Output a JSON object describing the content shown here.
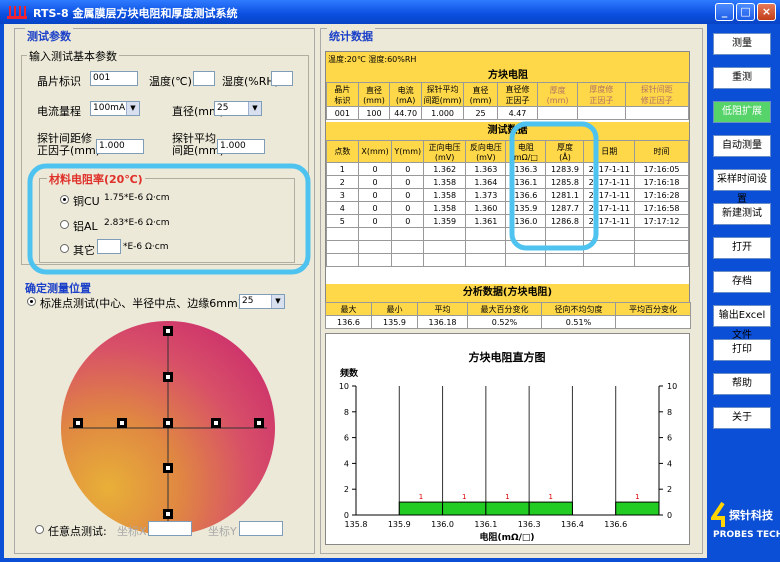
{
  "window": {
    "title": "RTS-8 金属膜层方块电阻和厚度测试系统",
    "minimize": "_",
    "maximize": "□",
    "close": "×"
  },
  "left": {
    "section_title": "测试参数",
    "basic_title": "输入测试基本参数",
    "sample_id_label": "晶片标识",
    "sample_id_value": "001",
    "temp_label": "温度(℃)",
    "temp_value": "",
    "humidity_label": "湿度(%RH)",
    "humidity_value": "",
    "current_range_label": "电流量程",
    "current_range_value": "100mA",
    "diameter_label": "直径(mm)",
    "diameter_value": "25",
    "spacing_corr_label_1": "探针间距修",
    "spacing_corr_label_2": "正因子(mm)",
    "spacing_corr_value": "1.000",
    "spacing_avg_label_1": "探针平均",
    "spacing_avg_label_2": "间距(mm)",
    "spacing_avg_value": "1.000",
    "resistivity_title": "材料电阻率(20℃)",
    "materials": [
      {
        "name": "铜CU",
        "value": "1.75*E-6 Ω·cm",
        "selected": true
      },
      {
        "name": "铝AL",
        "value": "2.83*E-6 Ω·cm",
        "selected": false
      }
    ],
    "other_label": "其它",
    "other_value": "",
    "other_unit": "*E-6 Ω·cm",
    "position_title": "确定测量位置",
    "standard_label": "标准点测试(中心、半径中点、边缘6mm)",
    "standard_value": "25",
    "free_label": "任意点测试:",
    "coord_x_label": "坐标X",
    "coord_y_label": "坐标Y"
  },
  "stats": {
    "section_title": "统计数据",
    "env": "温度:20℃  湿度:60%RH",
    "sheet_title": "方块电阻",
    "sheet_headers": [
      "晶片\n标识",
      "直径\n(mm)",
      "电流\n(mA)",
      "探针平均\n间距(mm)",
      "直径\n(mm)",
      "直径修\n正因子",
      "厚度\n(mm)",
      "厚度修\n正因子",
      "探针间距\n修正因子"
    ],
    "sheet_values": [
      "001",
      "100",
      "44.70",
      "1.000",
      "25",
      "4.47",
      "",
      "",
      ""
    ],
    "data_title": "测试数据",
    "data_headers": [
      "点数",
      "X(mm)",
      "Y(mm)",
      "正向电压\n(mV)",
      "反向电压\n(mV)",
      "电阻\nmΩ/□",
      "厚度\n(Å)",
      "日期",
      "时间"
    ],
    "rows": [
      [
        "1",
        "0",
        "0",
        "1.362",
        "1.363",
        "136.3",
        "1283.9",
        "2017-1-11",
        "17:16:05"
      ],
      [
        "2",
        "0",
        "0",
        "1.358",
        "1.364",
        "136.1",
        "1285.8",
        "2017-1-11",
        "17:16:18"
      ],
      [
        "3",
        "0",
        "0",
        "1.358",
        "1.373",
        "136.6",
        "1281.1",
        "2017-1-11",
        "17:16:28"
      ],
      [
        "4",
        "0",
        "0",
        "1.358",
        "1.360",
        "135.9",
        "1287.7",
        "2017-1-11",
        "17:16:58"
      ],
      [
        "5",
        "0",
        "0",
        "1.359",
        "1.361",
        "136.0",
        "1286.8",
        "2017-1-11",
        "17:17:12"
      ]
    ],
    "analysis_title": "分析数据(方块电阻)",
    "analysis_headers": [
      "最大",
      "最小",
      "平均",
      "最大百分变化",
      "径向不均匀度",
      "平均百分变化"
    ],
    "analysis_values": [
      "136.6",
      "135.9",
      "136.18",
      "0.52%",
      "0.51%",
      ""
    ]
  },
  "chart_data": {
    "type": "bar",
    "title": "方块电阻直方图",
    "ylabel": "频数",
    "xlabel": "电阻(mΩ/□)",
    "categories": [
      "135.8",
      "135.9",
      "136.0",
      "136.1",
      "136.3",
      "136.4",
      "136.6"
    ],
    "values": [
      0,
      1,
      1,
      1,
      1,
      0,
      1
    ],
    "ylim": [
      0,
      10
    ],
    "yticks": [
      "0",
      "2",
      "4",
      "6",
      "8",
      "10"
    ],
    "bar_color": "#22cc22",
    "grid": true
  },
  "buttons": [
    "测量",
    "重测",
    "低阻扩展",
    "自动测量",
    "采样时间设置",
    "新建测试",
    "打开",
    "存档",
    "输出Excel文件",
    "打印",
    "帮助",
    "关于"
  ],
  "active_button": "低阻扩展",
  "logo": {
    "cn": "探针科技",
    "en": "PROBES TECH"
  }
}
